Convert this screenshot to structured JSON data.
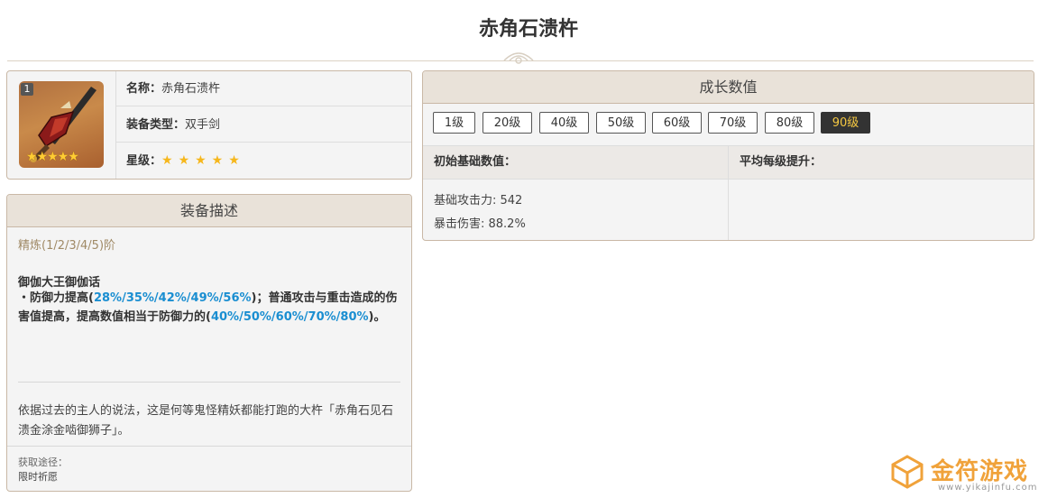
{
  "page": {
    "title": "赤角石溃杵"
  },
  "info": {
    "rank_badge": "1",
    "thumb_stars": "★★★★★",
    "name_label": "名称：",
    "name_value": "赤角石溃杵",
    "type_label": "装备类型：",
    "type_value": "双手剑",
    "star_label": "星级：",
    "star_value": "★★★★★"
  },
  "description": {
    "header": "装备描述",
    "refine": "精炼(1/2/3/4/5)阶",
    "skill_name": "御伽大王御伽话",
    "skill_part1": "・防御力提高(",
    "skill_values1": "28%/35%/42%/49%/56%",
    "skill_part2": ")；普通攻击与重击造成的伤害值提高，提高数值相当于防御力的(",
    "skill_values2": "40%/50%/60%/70%/80%",
    "skill_part3": ")。",
    "lore": "依据过去的主人的说法，这是何等鬼怪精妖都能打跑的大杵「赤角石见石溃金涂金啮御狮子」。",
    "source_label": "获取途径：",
    "source_value": "限时祈愿"
  },
  "growth": {
    "header": "成长数值",
    "levels": [
      "1级",
      "20级",
      "40级",
      "50级",
      "60级",
      "70级",
      "80级",
      "90级"
    ],
    "active_level": "90级",
    "col_base": "初始基础数值：",
    "col_avg": "平均每级提升：",
    "stat1": "基础攻击力: 542",
    "stat2": "暴击伤害: 88.2%"
  },
  "watermark": {
    "brand": "金符游戏",
    "url": "www.yikajinfu.com"
  },
  "colors": {
    "accent_blue": "#1a8ed1",
    "active_level_text": "#f5c842",
    "panel_border": "#c9b8a6"
  }
}
